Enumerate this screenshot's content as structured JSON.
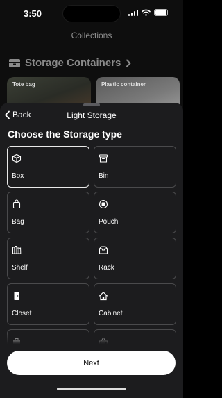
{
  "status_bar": {
    "time": "3:50"
  },
  "background": {
    "nav_title": "Collections",
    "section_title": "Storage Containers",
    "cards": [
      {
        "label": "Tote bag"
      },
      {
        "label": "Plastic container"
      }
    ]
  },
  "sheet": {
    "back_label": "Back",
    "title": "Light Storage",
    "heading": "Choose the Storage type",
    "options": [
      {
        "label": "Box",
        "icon": "box-icon",
        "selected": true
      },
      {
        "label": "Bin",
        "icon": "bin-icon",
        "selected": false
      },
      {
        "label": "Bag",
        "icon": "bag-icon",
        "selected": false
      },
      {
        "label": "Pouch",
        "icon": "pouch-icon",
        "selected": false
      },
      {
        "label": "Shelf",
        "icon": "shelf-icon",
        "selected": false
      },
      {
        "label": "Rack",
        "icon": "rack-icon",
        "selected": false
      },
      {
        "label": "Closet",
        "icon": "closet-icon",
        "selected": false
      },
      {
        "label": "Cabinet",
        "icon": "cabinet-icon",
        "selected": false
      },
      {
        "label": "",
        "icon": "briefcase-icon",
        "selected": false
      },
      {
        "label": "",
        "icon": "basket-icon",
        "selected": false
      }
    ],
    "next_label": "Next"
  }
}
